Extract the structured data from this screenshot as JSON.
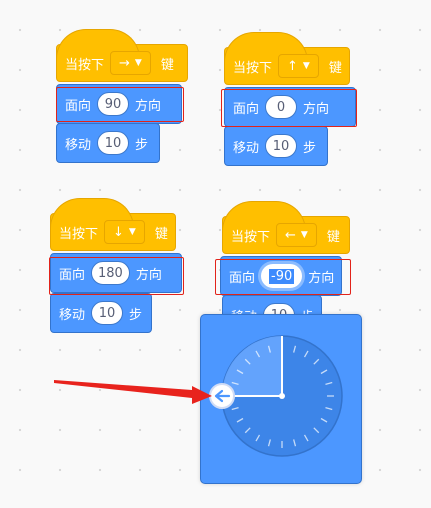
{
  "colors": {
    "event": "#ffbf00",
    "motion": "#4c97ff",
    "highlight": "#e2231a",
    "arrow": "#e8231d"
  },
  "scripts": [
    {
      "hat": {
        "prefix": "当按下",
        "key": "→",
        "suffix": "键"
      },
      "point": {
        "label": "面向",
        "value": "90",
        "suffix": "方向"
      },
      "move": {
        "label": "移动",
        "value": "10",
        "suffix": "步"
      }
    },
    {
      "hat": {
        "prefix": "当按下",
        "key": "↑",
        "suffix": "键"
      },
      "point": {
        "label": "面向",
        "value": "0",
        "suffix": "方向"
      },
      "move": {
        "label": "移动",
        "value": "10",
        "suffix": "步"
      }
    },
    {
      "hat": {
        "prefix": "当按下",
        "key": "↓",
        "suffix": "键"
      },
      "point": {
        "label": "面向",
        "value": "180",
        "suffix": "方向"
      },
      "move": {
        "label": "移动",
        "value": "10",
        "suffix": "步"
      }
    },
    {
      "hat": {
        "prefix": "当按下",
        "key": "←",
        "suffix": "键"
      },
      "point": {
        "label": "面向",
        "value": "-90",
        "suffix": "方向"
      },
      "move": {
        "label": "移动",
        "value": "10",
        "suffix": "步"
      }
    }
  ],
  "direction_picker": {
    "angle_degrees": -90,
    "handle_icon": "arrow-left-icon"
  }
}
